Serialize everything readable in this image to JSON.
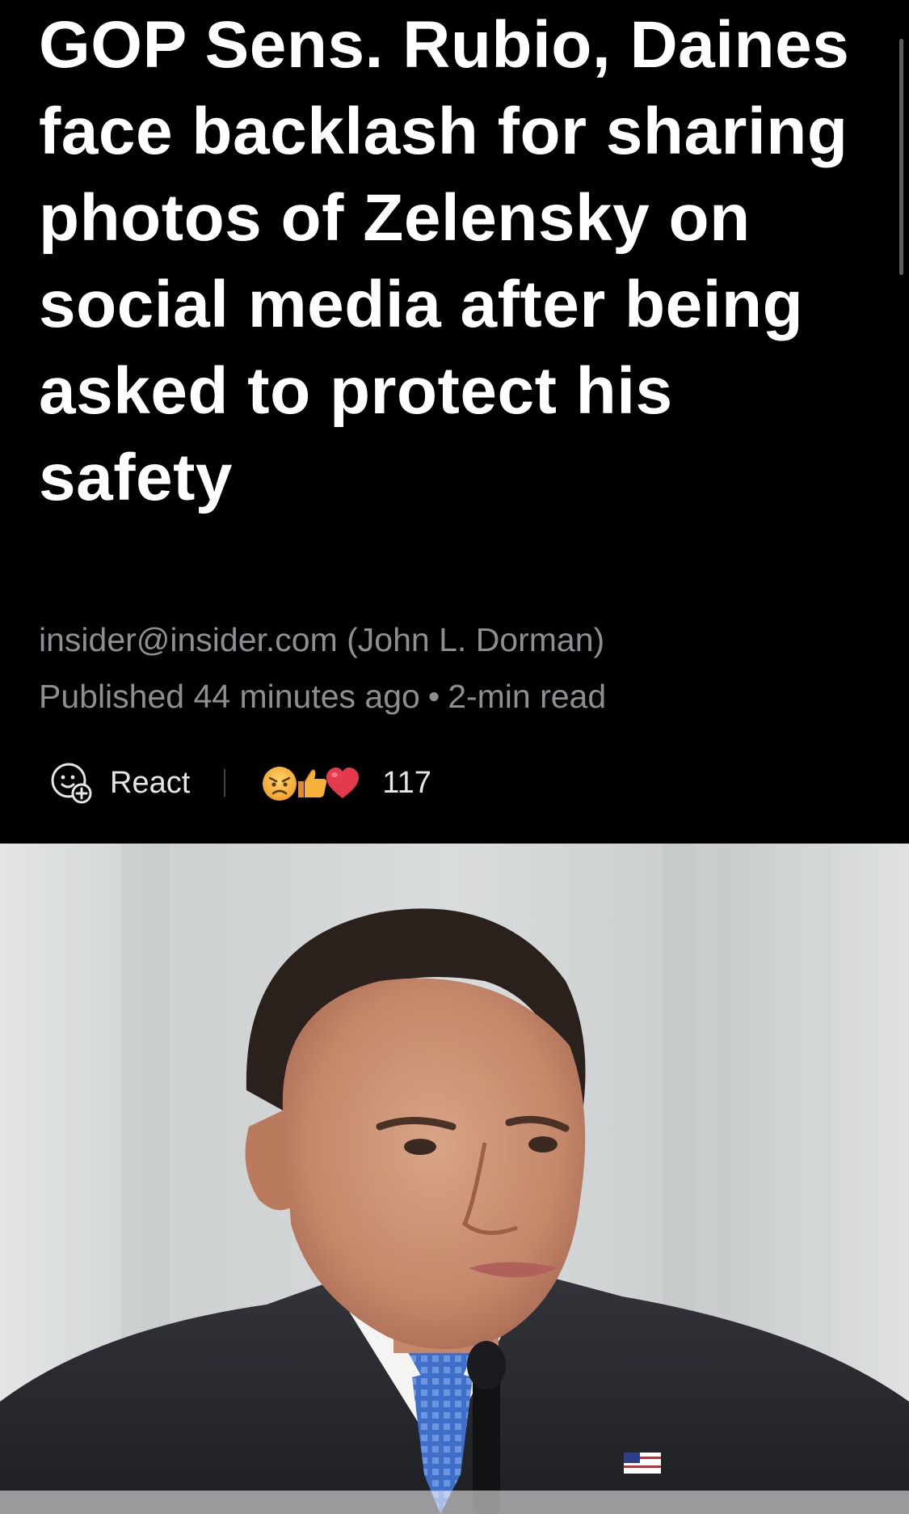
{
  "article": {
    "headline": "GOP Sens. Rubio, Daines face backlash for sharing photos of Zelensky on social media after being asked to protect his safety",
    "author": "insider@insider.com (John L. Dorman)",
    "published": "Published 44 minutes ago",
    "read_time": "2-min read",
    "separator": "•"
  },
  "reactions": {
    "react_label": "React",
    "count": "117",
    "emojis": [
      "angry-face",
      "thumbs-up",
      "red-heart"
    ]
  },
  "hero_image": {
    "subject": "man in dark suit with blue patterned tie speaking at a microphone"
  },
  "colors": {
    "background": "#000000",
    "headline": "#ffffff",
    "meta_text": "#8e8e93",
    "heart": "#e5394e"
  }
}
